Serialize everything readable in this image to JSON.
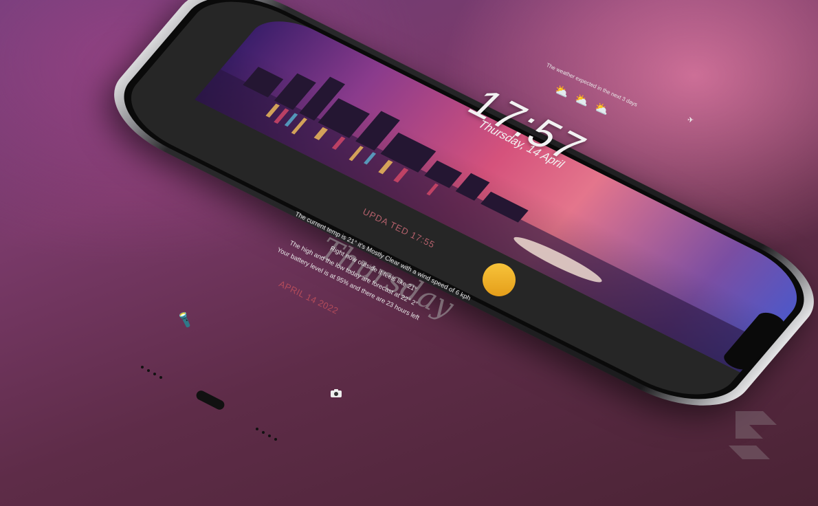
{
  "lockscreen": {
    "time": "17:57",
    "date": "Thursday, 14 April",
    "weather_caption": "The weather expected in the next 3 days",
    "weather_icons": [
      "partly-cloudy-icon",
      "partly-cloudy-icon",
      "partly-cloudy-icon"
    ]
  },
  "widget": {
    "updated": "UPDA TED 17:55",
    "lines": [
      "The current temp is 21° it's Mostly Clear with a wind speed of 6 kph",
      "Right now outside it feels like 21°",
      "The high and the low today are forecast at 22° 2°",
      "Your battery level is at 95% and there are 23 hours left"
    ],
    "script_day": "Thursday",
    "date": "APRIL 14 2022"
  },
  "colors": {
    "accent": "#b34b5a",
    "sun": "#f2b42a",
    "screen_bg": "#262626"
  },
  "icons": {
    "flashlight": "flashlight-icon",
    "camera": "camera-icon",
    "airplane": "airplane-icon"
  }
}
